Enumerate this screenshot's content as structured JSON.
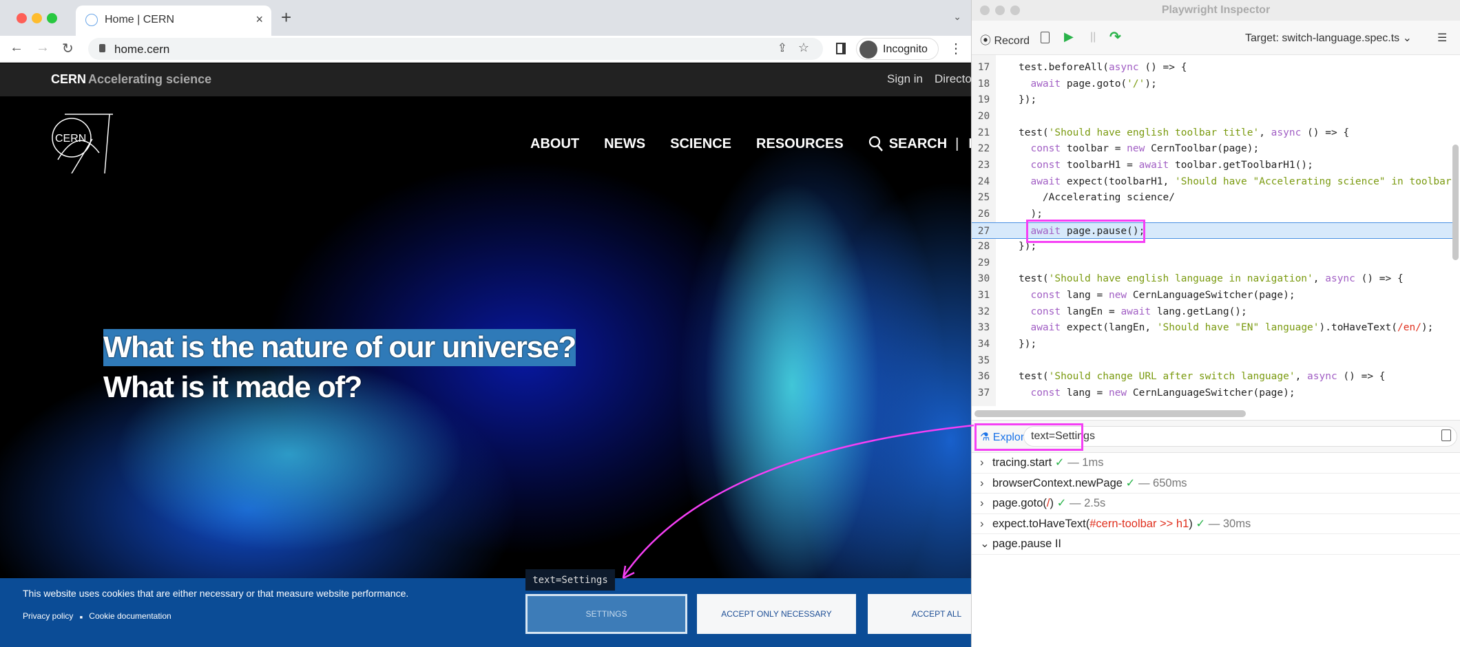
{
  "browser": {
    "tab_title": "Home | CERN",
    "url": "home.cern",
    "incognito_label": "Incognito"
  },
  "cern_toolbar": {
    "brand": "CERN",
    "tagline": "Accelerating science",
    "sign_in": "Sign in",
    "directory": "Directory"
  },
  "site": {
    "logo_text": "CERN",
    "nav": [
      "ABOUT",
      "NEWS",
      "SCIENCE",
      "RESOURCES"
    ],
    "search": "SEARCH",
    "separator": "|",
    "lang": "EN",
    "headline_1": "What is the nature of our universe?",
    "headline_2": "What is it made of?"
  },
  "cookie_banner": {
    "message": "This website uses cookies that are either necessary or that measure website performance.",
    "privacy": "Privacy policy",
    "bullet": "■",
    "cookie_doc": "Cookie documentation",
    "settings": "SETTINGS",
    "accept_necessary": "ACCEPT ONLY NECESSARY",
    "accept_all": "ACCEPT ALL"
  },
  "tooltip": "text=Settings",
  "inspector": {
    "title": "Playwright Inspector",
    "record": "Record",
    "target_label": "Target:",
    "target_value": "switch-language.spec.ts",
    "highlight_line": 27,
    "code": [
      {
        "n": "17",
        "t": [
          [
            "",
            "test.beforeAll("
          ],
          [
            "kw",
            "async"
          ],
          [
            "",
            " () => {"
          ]
        ]
      },
      {
        "n": "18",
        "t": [
          [
            "",
            "  "
          ],
          [
            "kw",
            "await"
          ],
          [
            "",
            " page.goto("
          ],
          [
            "str",
            "'/'"
          ],
          [
            "",
            ");"
          ]
        ]
      },
      {
        "n": "19",
        "t": [
          [
            "",
            "});"
          ]
        ]
      },
      {
        "n": "20",
        "t": []
      },
      {
        "n": "21",
        "t": [
          [
            "",
            "test("
          ],
          [
            "str",
            "'Should have english toolbar title'"
          ],
          [
            "",
            ", "
          ],
          [
            "kw",
            "async"
          ],
          [
            "",
            " () => {"
          ]
        ]
      },
      {
        "n": "22",
        "t": [
          [
            "",
            "  "
          ],
          [
            "kw",
            "const"
          ],
          [
            "",
            " toolbar = "
          ],
          [
            "kw",
            "new"
          ],
          [
            "",
            " CernToolbar(page);"
          ]
        ]
      },
      {
        "n": "23",
        "t": [
          [
            "",
            "  "
          ],
          [
            "kw",
            "const"
          ],
          [
            "",
            " toolbarH1 = "
          ],
          [
            "kw",
            "await"
          ],
          [
            "",
            " toolbar.getToolbarH1();"
          ]
        ]
      },
      {
        "n": "24",
        "t": [
          [
            "",
            "  "
          ],
          [
            "kw",
            "await"
          ],
          [
            "",
            " expect(toolbarH1, "
          ],
          [
            "str",
            "'Should have \"Accelerating science\" in toolbar"
          ]
        ]
      },
      {
        "n": "25",
        "t": [
          [
            "",
            "    /Accelerating science/"
          ]
        ]
      },
      {
        "n": "26",
        "t": [
          [
            "",
            "  );"
          ]
        ]
      },
      {
        "n": "27",
        "t": [
          [
            "",
            "  "
          ],
          [
            "kw",
            "await"
          ],
          [
            "",
            " page.pause();"
          ]
        ]
      },
      {
        "n": "28",
        "t": [
          [
            "",
            "});"
          ]
        ]
      },
      {
        "n": "29",
        "t": []
      },
      {
        "n": "30",
        "t": [
          [
            "",
            "test("
          ],
          [
            "str",
            "'Should have english language in navigation'"
          ],
          [
            "",
            ", "
          ],
          [
            "kw",
            "async"
          ],
          [
            "",
            " () => {"
          ]
        ]
      },
      {
        "n": "31",
        "t": [
          [
            "",
            "  "
          ],
          [
            "kw",
            "const"
          ],
          [
            "",
            " lang = "
          ],
          [
            "kw",
            "new"
          ],
          [
            "",
            " CernLanguageSwitcher(page);"
          ]
        ]
      },
      {
        "n": "32",
        "t": [
          [
            "",
            "  "
          ],
          [
            "kw",
            "const"
          ],
          [
            "",
            " langEn = "
          ],
          [
            "kw",
            "await"
          ],
          [
            "",
            " lang.getLang();"
          ]
        ]
      },
      {
        "n": "33",
        "t": [
          [
            "",
            "  "
          ],
          [
            "kw",
            "await"
          ],
          [
            "",
            " expect(langEn, "
          ],
          [
            "str",
            "'Should have \"EN\" language'"
          ],
          [
            "",
            ").toHaveText("
          ],
          [
            "re",
            "/en/"
          ],
          [
            "",
            ");"
          ]
        ]
      },
      {
        "n": "34",
        "t": [
          [
            "",
            "});"
          ]
        ]
      },
      {
        "n": "35",
        "t": []
      },
      {
        "n": "36",
        "t": [
          [
            "",
            "test("
          ],
          [
            "str",
            "'Should change URL after switch language'"
          ],
          [
            "",
            ", "
          ],
          [
            "kw",
            "async"
          ],
          [
            "",
            " () => {"
          ]
        ]
      },
      {
        "n": "37",
        "t": [
          [
            "",
            "  "
          ],
          [
            "kw",
            "const"
          ],
          [
            "",
            " lang = "
          ],
          [
            "kw",
            "new"
          ],
          [
            "",
            " CernLanguageSwitcher(page);"
          ]
        ]
      }
    ],
    "explore_label": "Explore",
    "selector": "text=Settings",
    "log": [
      {
        "name": "tracing.start",
        "sel": "",
        "close": "",
        "status": "✓",
        "dur": "— 1ms",
        "expanded": false
      },
      {
        "name": "browserContext.newPage",
        "sel": "",
        "close": "",
        "status": "✓",
        "dur": "— 650ms",
        "expanded": false
      },
      {
        "name": "page.goto(",
        "sel": "/",
        "close": ")",
        "status": "✓",
        "dur": "— 2.5s",
        "expanded": false
      },
      {
        "name": "expect.toHaveText(",
        "sel": "#cern-toolbar >> h1",
        "close": ")",
        "status": "✓",
        "dur": "— 30ms",
        "expanded": false
      },
      {
        "name": "page.pause",
        "sel": "",
        "close": "",
        "status": "II",
        "dur": "",
        "expanded": true
      }
    ]
  },
  "colors": {
    "highlight": "#f53ff5",
    "accent": "#1a73e8",
    "success": "#2ab34a",
    "cookie_bg": "#0b4c96"
  }
}
